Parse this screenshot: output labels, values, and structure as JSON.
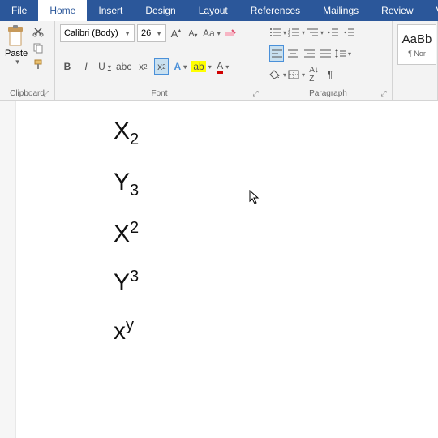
{
  "tabs": {
    "file": "File",
    "home": "Home",
    "insert": "Insert",
    "design": "Design",
    "layout": "Layout",
    "references": "References",
    "mailings": "Mailings",
    "review": "Review",
    "view": "Vi"
  },
  "clipboard": {
    "paste": "Paste",
    "label": "Clipboard"
  },
  "font": {
    "name": "Calibri (Body)",
    "size": "26",
    "label": "Font"
  },
  "paragraph": {
    "label": "Paragraph"
  },
  "styles": {
    "sample": "AaBb",
    "name": "¶ Nor"
  },
  "doc": {
    "l1": {
      "base": "X",
      "sub": "2"
    },
    "l2": {
      "base": "Y",
      "sub": "3"
    },
    "l3": {
      "base": "X",
      "sup": "2"
    },
    "l4": {
      "base": "Y",
      "sup": "3"
    },
    "l5": {
      "base": "x",
      "sup": "y"
    }
  }
}
